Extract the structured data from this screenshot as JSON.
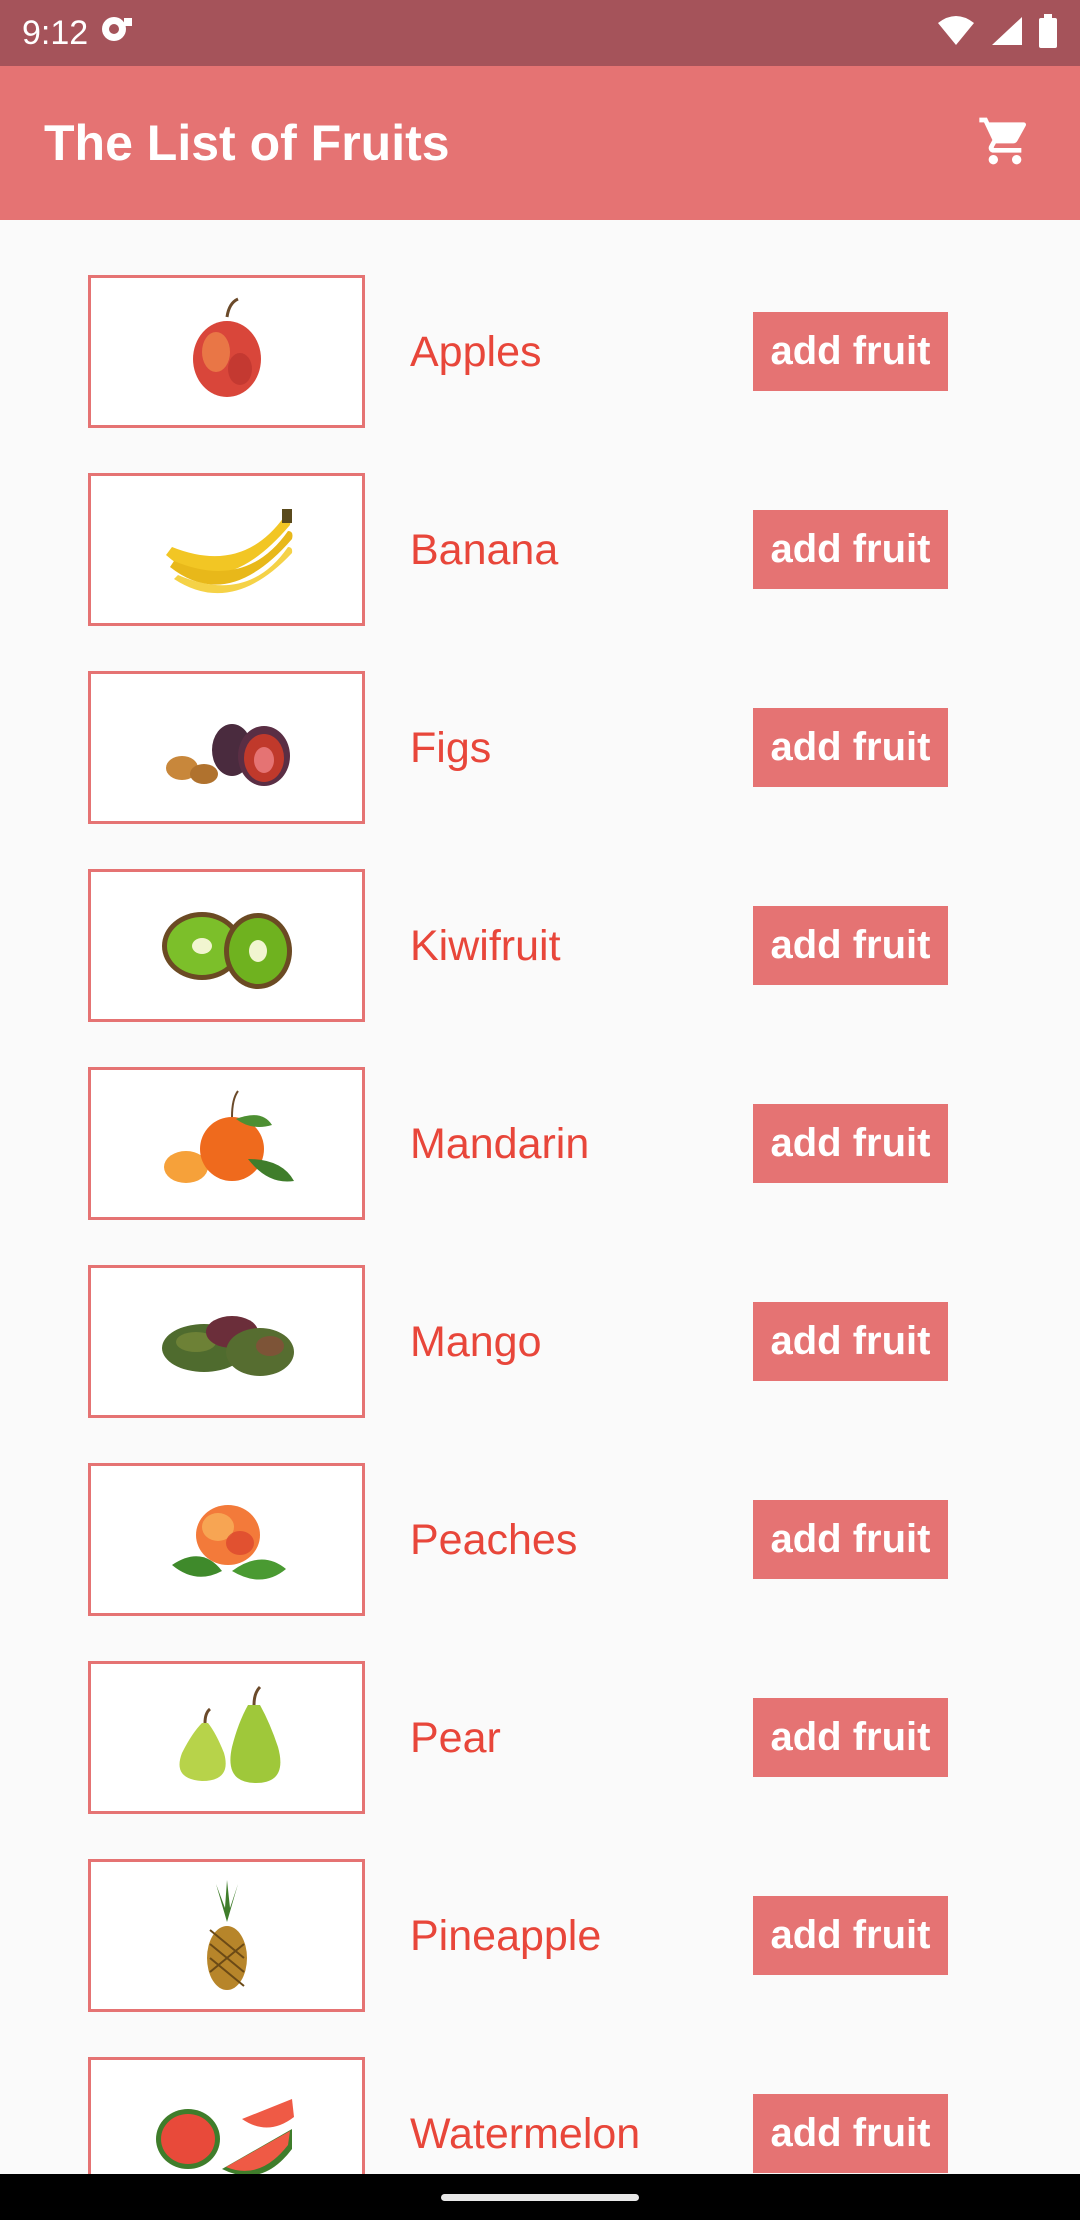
{
  "status_bar": {
    "time": "9:12",
    "icons": [
      "notification-icon",
      "wifi-icon",
      "signal-icon",
      "battery-icon"
    ]
  },
  "app_bar": {
    "title": "The List of Fruits",
    "cart_icon": "cart-icon"
  },
  "fruits": [
    {
      "name": "Apples",
      "button": "add fruit"
    },
    {
      "name": "Banana",
      "button": "add fruit"
    },
    {
      "name": "Figs",
      "button": "add fruit"
    },
    {
      "name": "Kiwifruit",
      "button": "add fruit"
    },
    {
      "name": "Mandarin",
      "button": "add fruit"
    },
    {
      "name": "Mango",
      "button": "add fruit"
    },
    {
      "name": "Peaches",
      "button": "add fruit"
    },
    {
      "name": "Pear",
      "button": "add fruit"
    },
    {
      "name": "Pineapple",
      "button": "add fruit"
    },
    {
      "name": "Watermelon",
      "button": "add fruit"
    }
  ],
  "colors": {
    "status_bar": "#a5535a",
    "primary": "#e57373",
    "fruit_text": "#e8463a",
    "background": "#fafafa"
  }
}
